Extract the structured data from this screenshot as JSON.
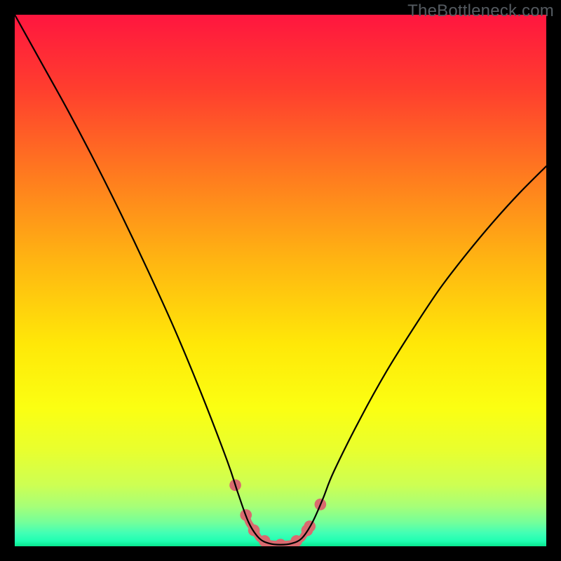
{
  "watermark": "TheBottleneck.com",
  "chart_data": {
    "type": "line",
    "title": "",
    "xlabel": "",
    "ylabel": "",
    "xlim": [
      0,
      100
    ],
    "ylim": [
      0,
      100
    ],
    "x": [
      0,
      5,
      10,
      15,
      20,
      25,
      30,
      35,
      40,
      42,
      44,
      46,
      48,
      50,
      52,
      54,
      56,
      58,
      60,
      65,
      70,
      75,
      80,
      85,
      90,
      95,
      100
    ],
    "y": [
      100,
      91,
      82,
      72.5,
      62.5,
      52,
      41,
      29,
      16,
      10,
      4.5,
      1.5,
      0.5,
      0.3,
      0.5,
      1.5,
      4.5,
      9,
      14,
      24,
      33,
      41,
      48.5,
      55,
      61,
      66.5,
      71.5
    ],
    "flat_range_x": [
      43.5,
      55.5
    ],
    "highlight_points_x": [
      41.5,
      43.5,
      45,
      47,
      50,
      53,
      55,
      55.5,
      57.5
    ],
    "gradient_stops": [
      {
        "offset": 0.0,
        "color": "#ff163f"
      },
      {
        "offset": 0.14,
        "color": "#ff3e2e"
      },
      {
        "offset": 0.3,
        "color": "#ff7a1f"
      },
      {
        "offset": 0.46,
        "color": "#ffb412"
      },
      {
        "offset": 0.62,
        "color": "#ffe808"
      },
      {
        "offset": 0.74,
        "color": "#fbff12"
      },
      {
        "offset": 0.82,
        "color": "#e8ff2f"
      },
      {
        "offset": 0.885,
        "color": "#cdff53"
      },
      {
        "offset": 0.925,
        "color": "#a6ff78"
      },
      {
        "offset": 0.955,
        "color": "#74ff9a"
      },
      {
        "offset": 0.975,
        "color": "#42ffb5"
      },
      {
        "offset": 0.99,
        "color": "#1fffb2"
      },
      {
        "offset": 1.0,
        "color": "#08e68f"
      }
    ],
    "curve_color": "#000000",
    "highlight_color": "#d96a6f",
    "highlight_radius_frac": 0.011,
    "highlight_line_width_frac": 0.013
  }
}
